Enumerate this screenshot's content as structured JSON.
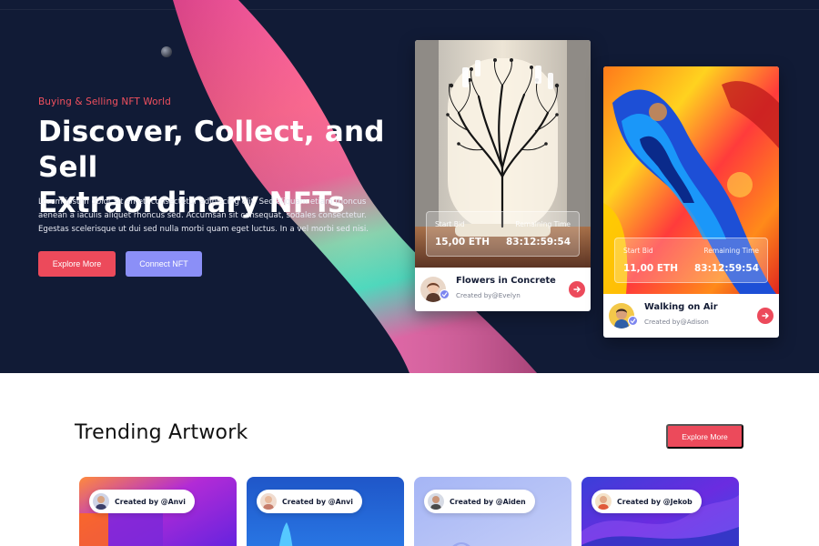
{
  "hero": {
    "eyebrow": "Buying & Selling NFT World",
    "title_line1": "Discover, Collect, and Sell",
    "title_line2": "Extraordinary NFTs",
    "description": "Lorem ipsum dolor sit amet, consectetur adipiscing elit. Sed aliquam etiam rhoncus aenean a iaculis aliquet rhoncus sed. Accumsan sit consequat, sodales consectetur. Egestas scelerisque ut dui sed nulla morbi quam eget luctus. In a vel morbi sed nisi.",
    "explore_label": "Explore More",
    "connect_label": "Connect NFT"
  },
  "nft_cards": [
    {
      "start_bid_label": "Start Bid",
      "start_bid_value": "15,00 ETH",
      "remaining_label": "Remaining Time",
      "remaining_value": "83:12:59:54",
      "name": "Flowers in Concrete",
      "created_by": "Created by@Evelyn"
    },
    {
      "start_bid_label": "Start Bid",
      "start_bid_value": "11,00 ETH",
      "remaining_label": "Remaining Time",
      "remaining_value": "83:12:59:54",
      "name": "Walking on Air",
      "created_by": "Created by@Adison"
    }
  ],
  "trending": {
    "title": "Trending Artwork",
    "explore_label": "Explore More",
    "cards": [
      {
        "creator": "Created by @Anvi"
      },
      {
        "creator": "Created by @Anvi"
      },
      {
        "creator": "Created by @Aiden"
      },
      {
        "creator": "Created by @Jekob"
      }
    ]
  },
  "colors": {
    "hero_bg": "#111b36",
    "accent_red": "#ec4a5b",
    "accent_purple": "#8b8ff7"
  },
  "icons": [
    "verified-badge-icon",
    "arrow-right-icon"
  ]
}
